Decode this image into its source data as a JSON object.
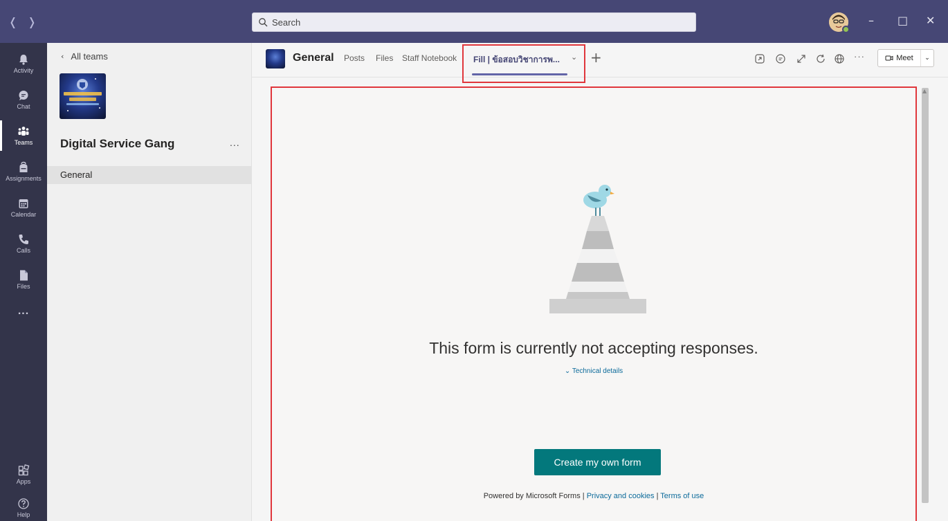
{
  "titlebar": {
    "back_icon": "chevron-left-icon",
    "forward_icon": "chevron-right-icon",
    "search_placeholder": "Search",
    "minimize": "–",
    "maximize": "□",
    "close": "✕"
  },
  "rail": [
    {
      "label": "Activity",
      "icon": "bell-icon"
    },
    {
      "label": "Chat",
      "icon": "chat-icon"
    },
    {
      "label": "Teams",
      "icon": "teams-icon",
      "active": true
    },
    {
      "label": "Assignments",
      "icon": "backpack-icon"
    },
    {
      "label": "Calendar",
      "icon": "calendar-icon"
    },
    {
      "label": "Calls",
      "icon": "phone-icon"
    },
    {
      "label": "Files",
      "icon": "file-icon"
    },
    {
      "label": "...",
      "icon": "more-icon"
    },
    {
      "label": "Apps",
      "icon": "apps-icon"
    },
    {
      "label": "Help",
      "icon": "help-icon"
    }
  ],
  "teampanel": {
    "back_label": "All teams",
    "team_name": "Digital Service Gang",
    "more": "...",
    "channel": "General"
  },
  "header": {
    "channel_title": "General",
    "tabs": [
      "Posts",
      "Files",
      "Staff Notebook",
      "Fill | ข้อสอบวิชาการพ..."
    ],
    "add_tab": "+",
    "meet_label": "Meet"
  },
  "content": {
    "message": "This form is currently not accepting responses.",
    "technical_details": "Technical details",
    "create_button": "Create my own form",
    "footer_prefix": "Powered by Microsoft Forms |",
    "privacy_link": "Privacy and cookies",
    "separator": "|",
    "terms_link": "Terms of use"
  },
  "colors": {
    "titlebar": "#464775",
    "rail": "#33344a",
    "accent": "#6264a7",
    "create_button": "#03787c",
    "highlight": "#e0363b"
  }
}
